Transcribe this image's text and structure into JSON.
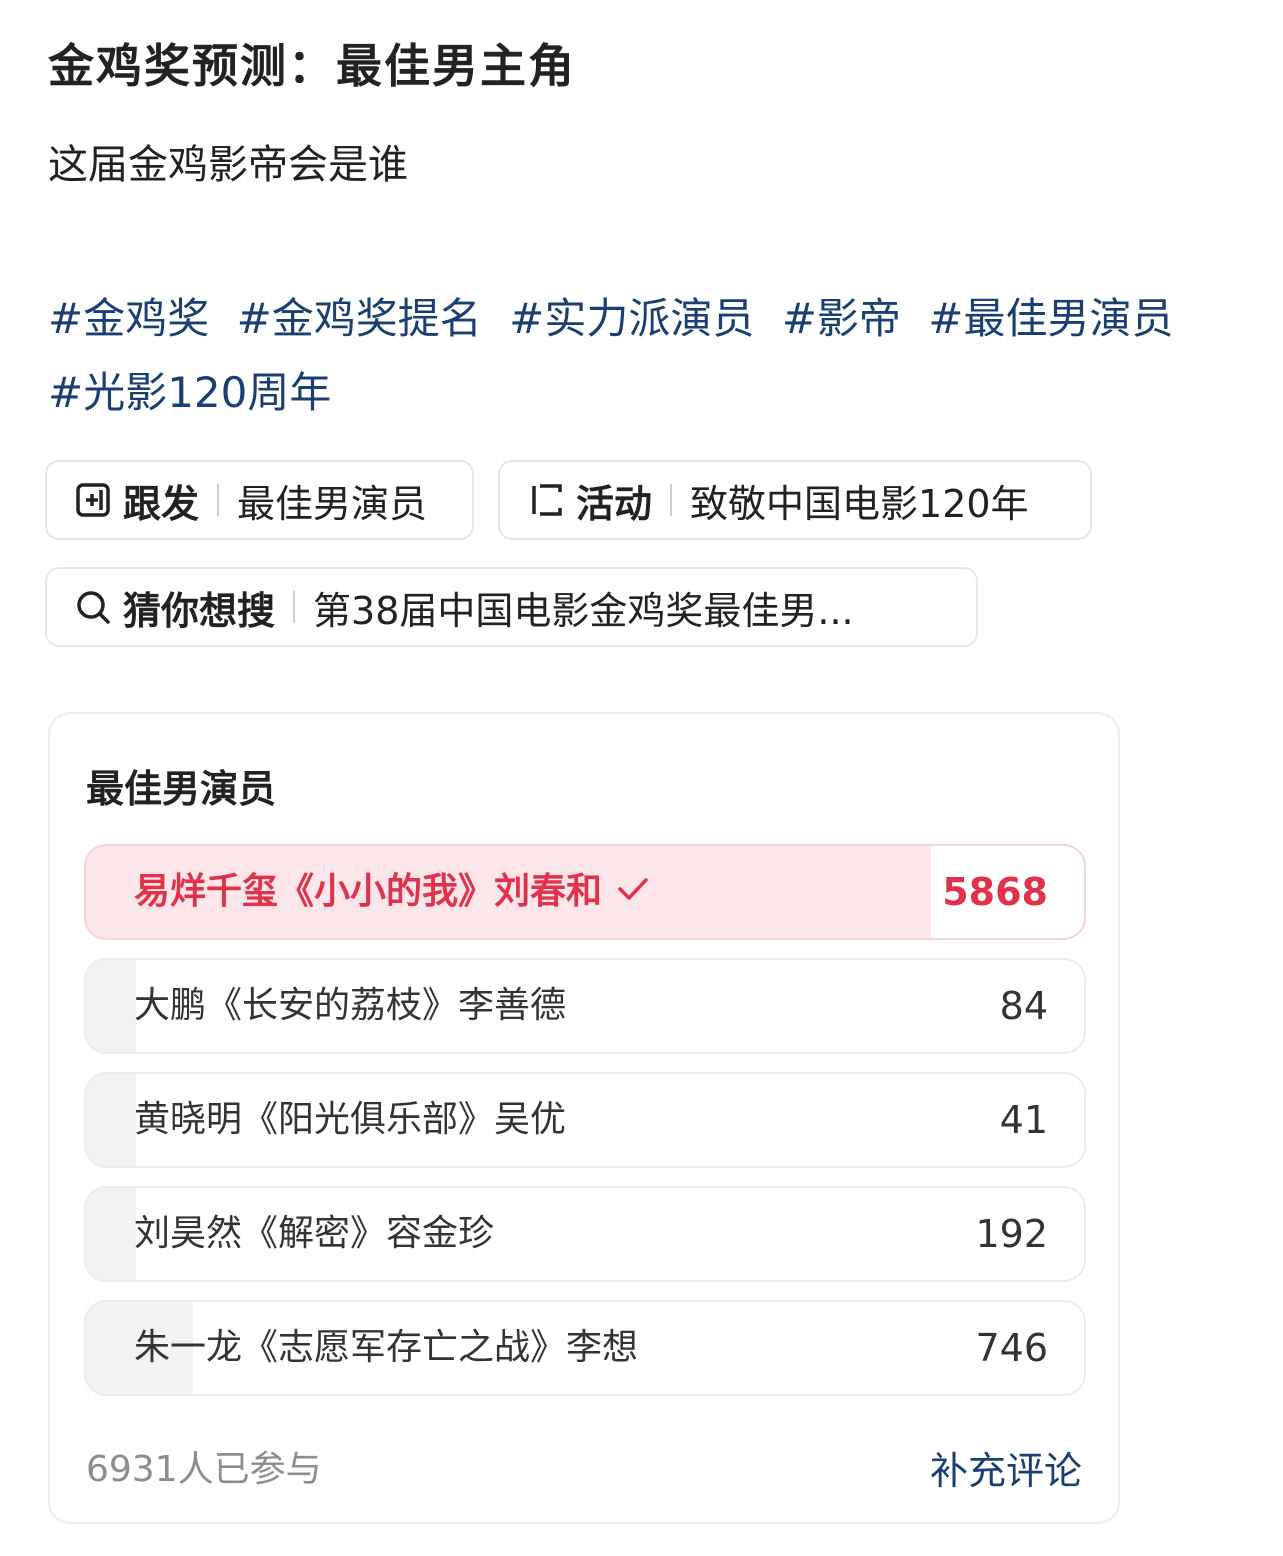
{
  "post": {
    "title": "金鸡奖预测：最佳男主角",
    "text": "这届金鸡影帝会是谁",
    "hashtags": [
      "#金鸡奖",
      "#金鸡奖提名",
      "#实力派演员",
      "#影帝",
      "#最佳男演员",
      "#光影120周年"
    ]
  },
  "chips": {
    "follow": {
      "key": "跟发",
      "value": "最佳男演员",
      "icon": "plus-box-icon"
    },
    "activity": {
      "key": "活动",
      "value": "致敬中国电影120年",
      "icon": "bracket-icon"
    },
    "search": {
      "key": "猜你想搜",
      "value": "第38届中国电影金鸡奖最佳男...",
      "icon": "search-icon"
    }
  },
  "poll": {
    "title": "最佳男演员",
    "options": [
      {
        "label": "易烊千玺《小小的我》刘春和",
        "count": "5868",
        "votes": 5868,
        "selected": true
      },
      {
        "label": "大鹏《长安的荔枝》李善德",
        "count": "84",
        "votes": 84,
        "selected": false
      },
      {
        "label": "黄晓明《阳光俱乐部》吴优",
        "count": "41",
        "votes": 41,
        "selected": false
      },
      {
        "label": "刘昊然《解密》容金珍",
        "count": "192",
        "votes": 192,
        "selected": false
      },
      {
        "label": "朱一龙《志愿军存亡之战》李想",
        "count": "746",
        "votes": 746,
        "selected": false
      }
    ],
    "participants": "6931人已参与",
    "comment_label": "补充评论"
  },
  "colors": {
    "accent_red": "#e0334b",
    "link_blue": "#1c3f73",
    "selected_fill": "#fde6ea",
    "bar_fill": "#f2f2f2"
  }
}
